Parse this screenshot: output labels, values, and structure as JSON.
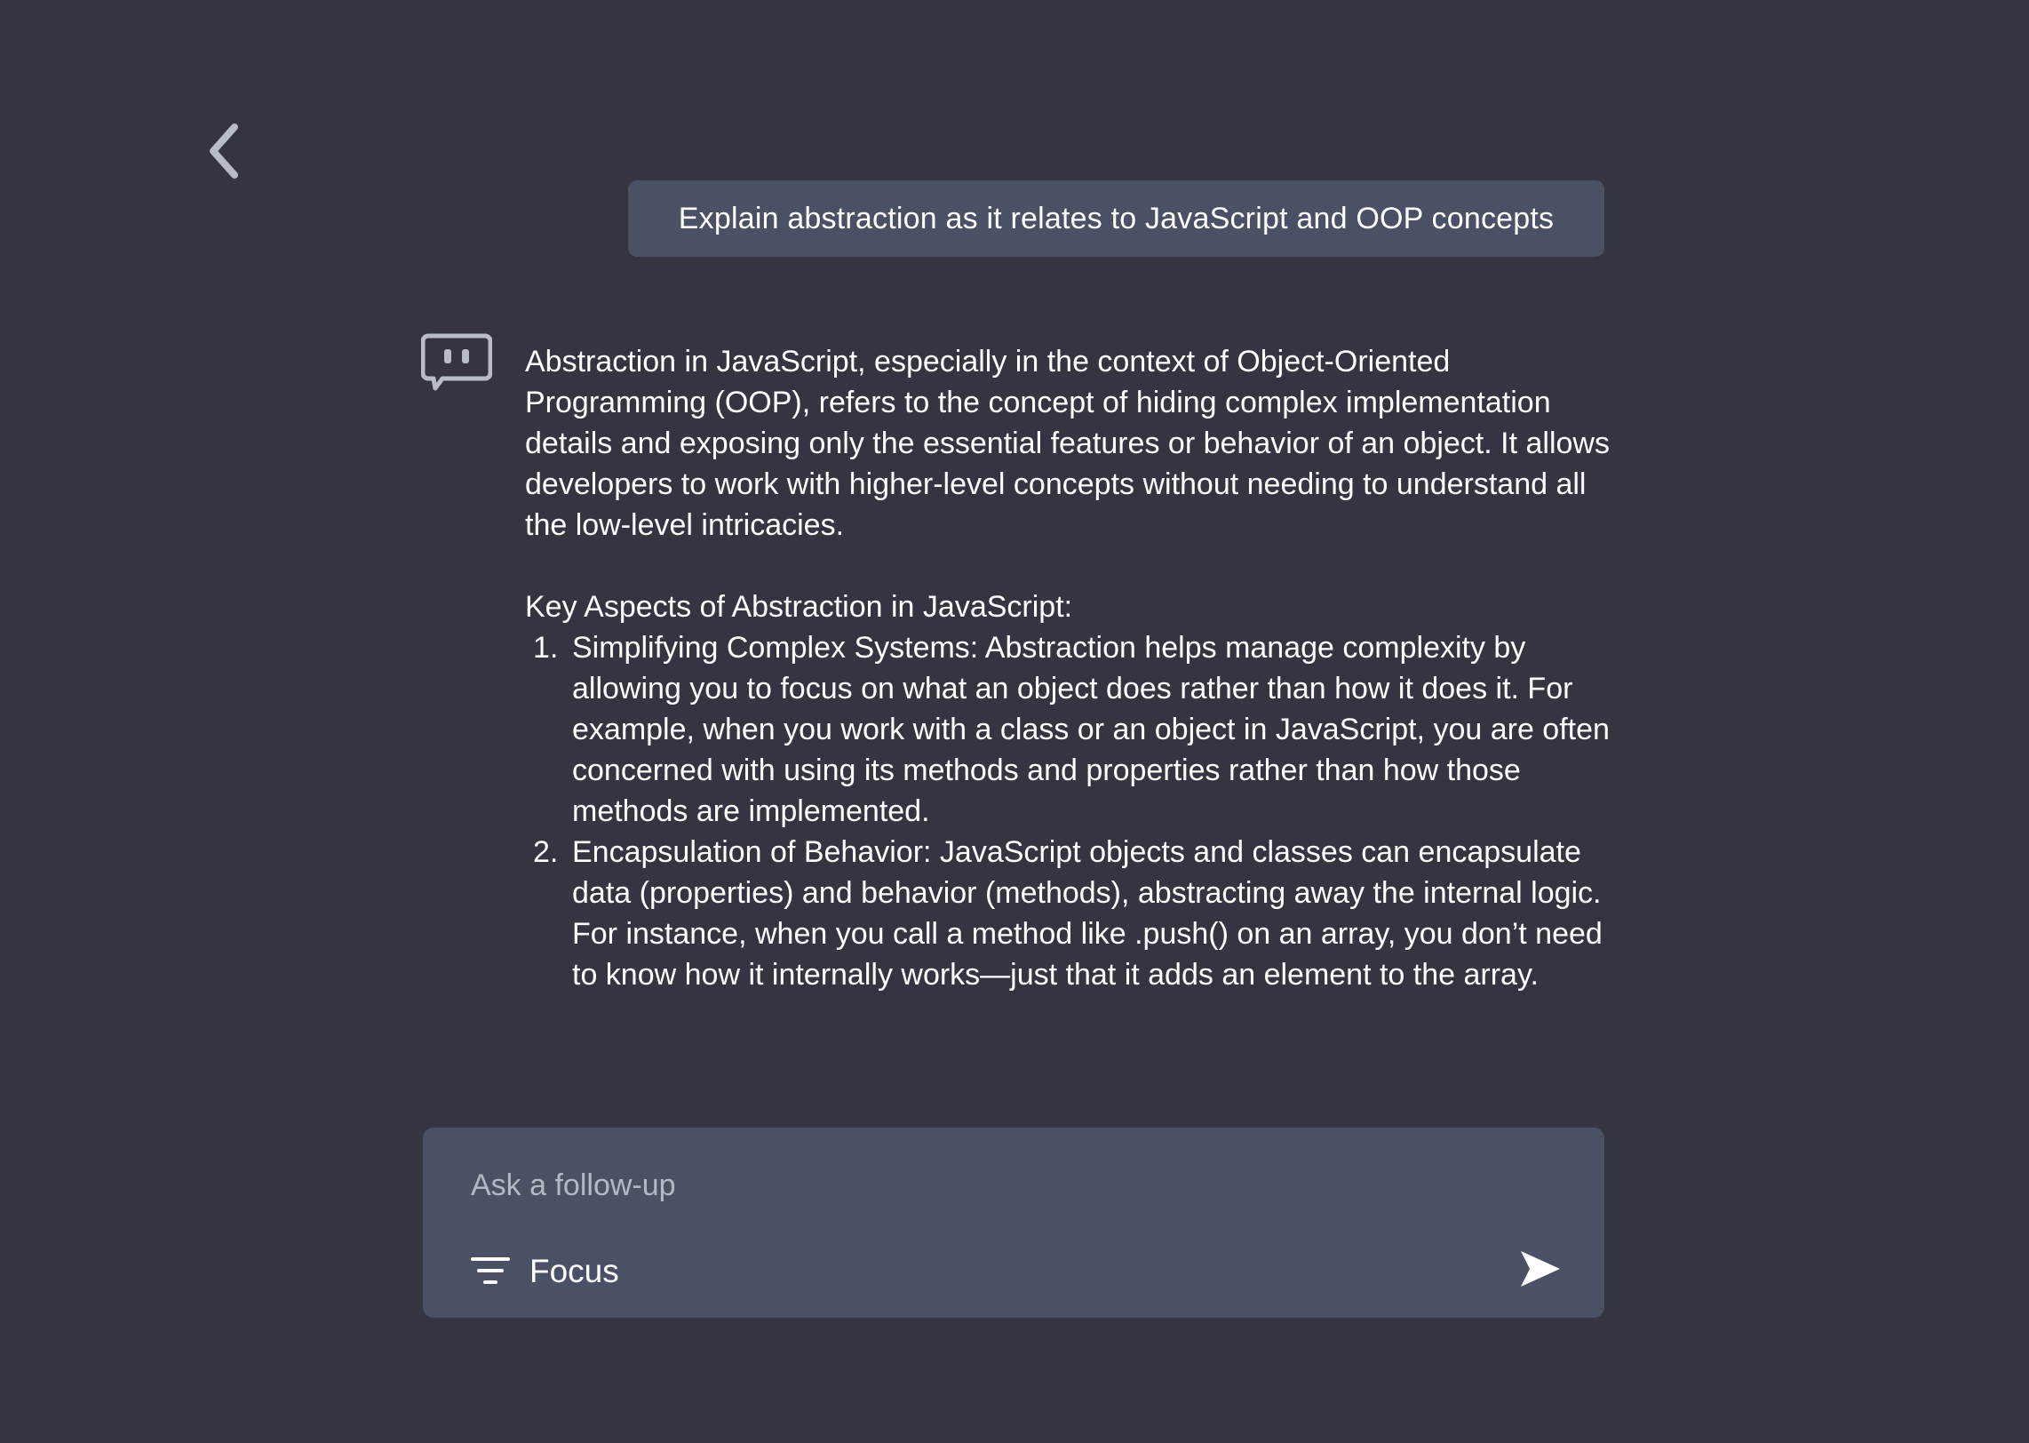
{
  "nav": {
    "back_icon": "chevron-left-icon"
  },
  "user_message": {
    "text": "Explain abstraction as it relates to JavaScript and OOP concepts"
  },
  "assistant": {
    "avatar_icon": "bot-chat-icon",
    "intro": "Abstraction in JavaScript, especially in the context of Object-Oriented Programming (OOP), refers to the concept of hiding complex implementation details and exposing only the essential features or behavior of an object. It allows developers to work with higher-level concepts without needing to understand all the low-level intricacies.",
    "heading": "Key Aspects of Abstraction in JavaScript:",
    "items": [
      {
        "number": "1.",
        "text": "Simplifying Complex Systems: Abstraction helps manage complexity by allowing you to focus on what an object does rather than how it does it. For example, when you work with a class or an object in JavaScript, you are often concerned with using its methods and properties rather than how those methods are implemented."
      },
      {
        "number": "2.",
        "text": "Encapsulation of Behavior: JavaScript objects and classes can encapsulate data (properties) and behavior (methods), abstracting away the internal logic. For instance, when you call a method like .push() on an array, you don’t need to know how it internally works—just that it adds an element to the array."
      }
    ]
  },
  "composer": {
    "placeholder": "Ask a follow-up",
    "value": "",
    "focus_label": "Focus",
    "focus_icon": "filter-icon",
    "send_icon": "send-arrow-icon"
  },
  "colors": {
    "background": "#343541",
    "bubble": "#4b5164",
    "text": "#ffffff",
    "placeholder": "#b4b8c4",
    "icon_muted": "#b8bcc8"
  }
}
